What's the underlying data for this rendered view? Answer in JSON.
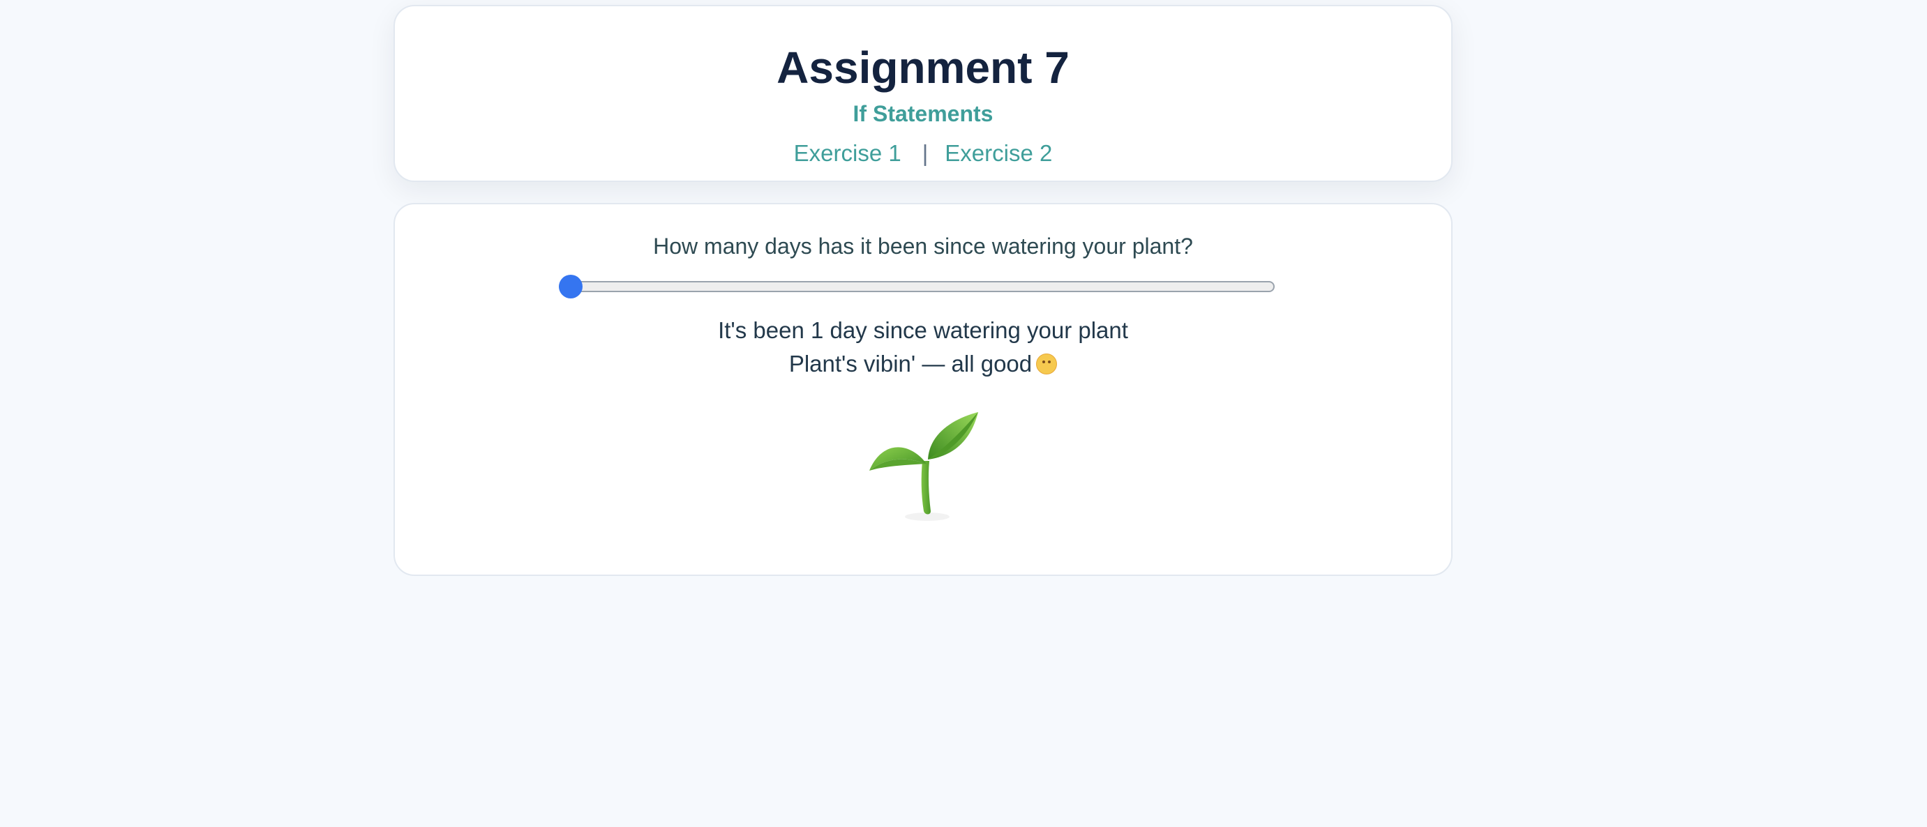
{
  "header": {
    "title": "Assignment 7",
    "subtitle": "If Statements",
    "nav": {
      "exercise1": "Exercise 1",
      "separator": "|",
      "exercise2": "Exercise 2"
    }
  },
  "exercise": {
    "question": "How many days has it been since watering your plant?",
    "slider": {
      "value": 1,
      "position_fraction": 0.0
    },
    "days_message": "It's been 1 day since watering your plant",
    "status_message": "Plant's vibin' — all good",
    "status_icon": "smiling-face-icon",
    "plant_icon": "seedling-icon"
  },
  "colors": {
    "accent": "#3f9e9a",
    "title": "#14233f",
    "slider_thumb": "#3575f0",
    "background": "#f6f9fd"
  }
}
